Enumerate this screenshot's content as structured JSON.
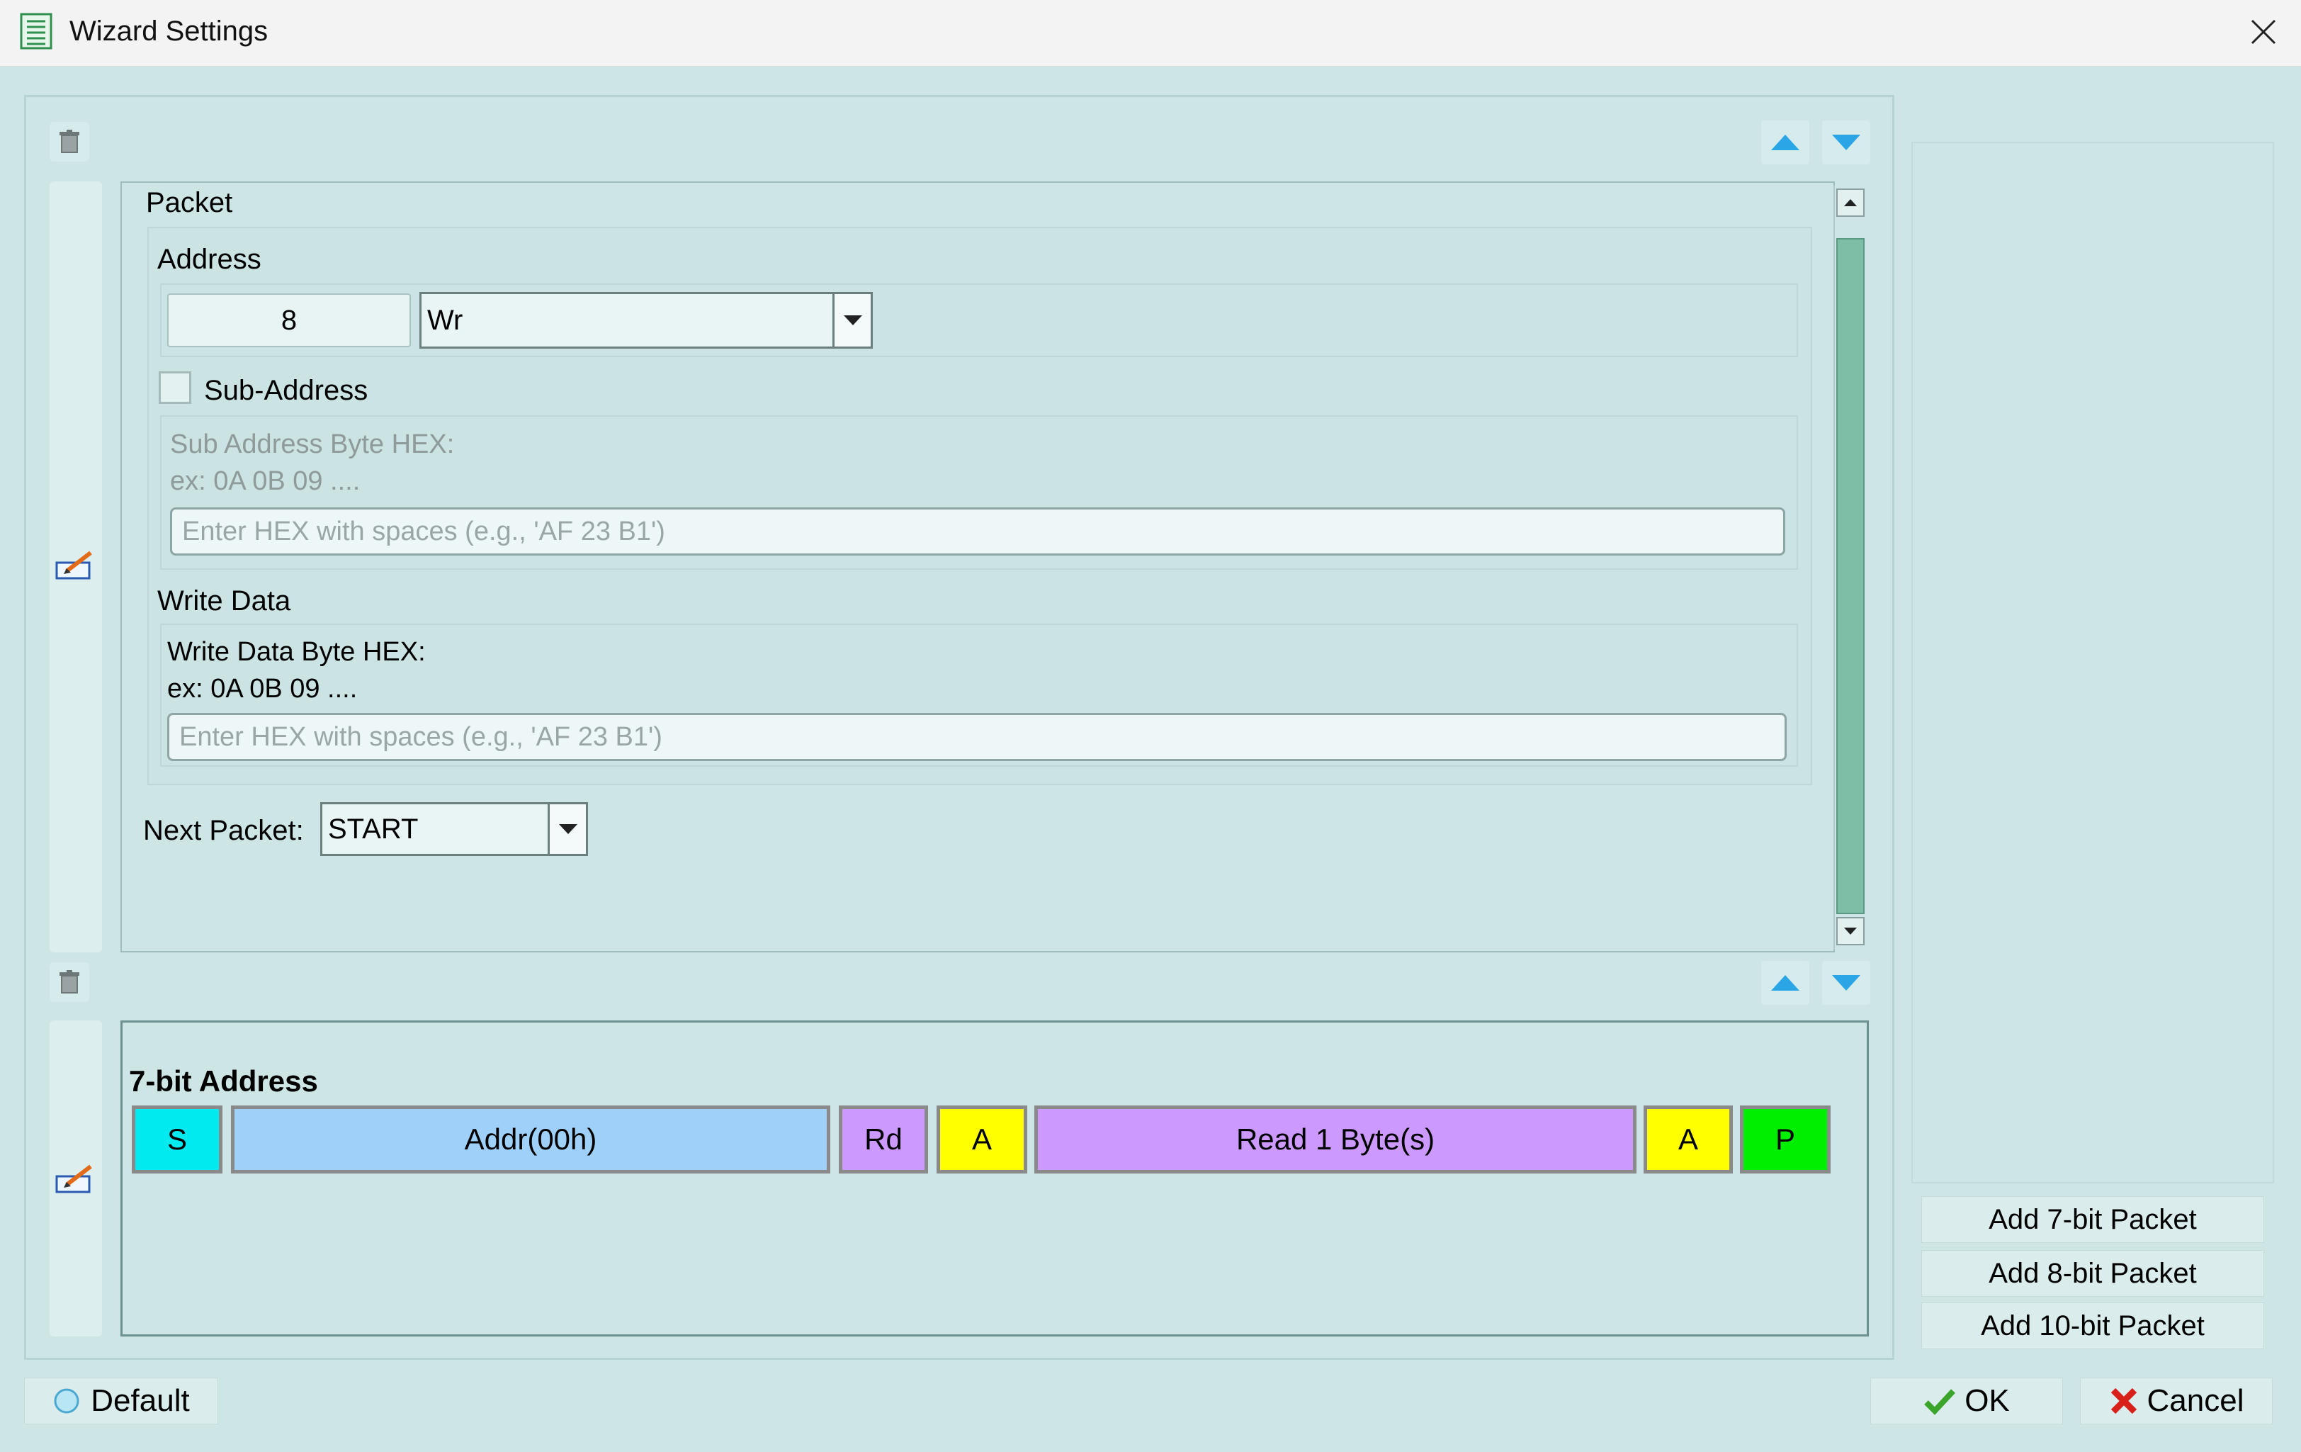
{
  "window": {
    "title": "Wizard Settings"
  },
  "packet": {
    "title": "Packet",
    "address": {
      "label": "Address",
      "value": "8",
      "mode": "Wr"
    },
    "sub_address": {
      "checkbox_label": "Sub-Address",
      "checked": false,
      "hint_line1": "Sub Address Byte HEX:",
      "hint_line2": "ex: 0A 0B 09 ....",
      "placeholder": "Enter HEX with spaces (e.g., 'AF 23 B1')"
    },
    "write_data": {
      "label": "Write Data",
      "hint_line1": "Write Data Byte HEX:",
      "hint_line2": "ex: 0A 0B 09 ....",
      "placeholder": "Enter HEX with spaces (e.g., 'AF 23 B1')"
    },
    "next_packet": {
      "label": "Next Packet:",
      "value": "START"
    }
  },
  "packet2": {
    "title": "7-bit Address",
    "segments": [
      {
        "label": "S",
        "color": "#00eaf0"
      },
      {
        "label": "Addr(00h)",
        "color": "#9fd0fa"
      },
      {
        "label": "Rd",
        "color": "#cc99ff"
      },
      {
        "label": "A",
        "color": "#ffff00"
      },
      {
        "label": "Read 1 Byte(s)",
        "color": "#cc99ff"
      },
      {
        "label": "A",
        "color": "#ffff00"
      },
      {
        "label": "P",
        "color": "#00ee00"
      }
    ]
  },
  "right_panel": {
    "add_7bit": "Add 7-bit Packet",
    "add_8bit": "Add 8-bit Packet",
    "add_10bit": "Add 10-bit Packet"
  },
  "footer": {
    "default_label": "Default",
    "ok_label": "OK",
    "cancel_label": "Cancel"
  },
  "icons": {
    "app": "list-document-icon",
    "close": "close-icon",
    "trash": "trash-icon",
    "edit": "edit-icon",
    "move_up": "triangle-up-icon",
    "move_down": "triangle-down-icon",
    "ok": "checkmark-icon",
    "cancel": "red-x-icon",
    "default": "circle-icon"
  },
  "colors": {
    "background": "#cde5e5",
    "scroll_thumb": "#7ebea6",
    "arrow_blue": "#2aa6e6"
  }
}
